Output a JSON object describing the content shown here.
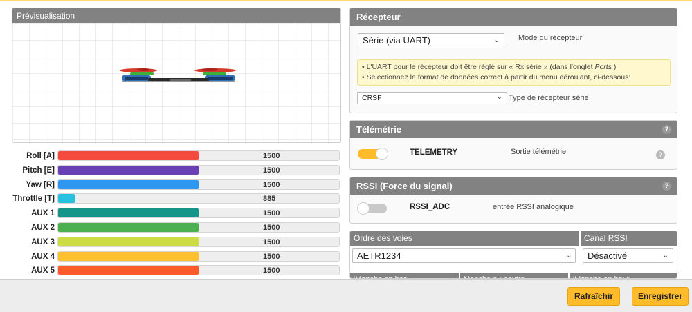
{
  "preview": {
    "title": "Prévisualisation"
  },
  "channels": [
    {
      "label": "Roll [A]",
      "value": "1500",
      "fill": 0.5,
      "color": "#f44b3f"
    },
    {
      "label": "Pitch [E]",
      "value": "1500",
      "fill": 0.5,
      "color": "#6a40b5"
    },
    {
      "label": "Yaw [R]",
      "value": "1500",
      "fill": 0.5,
      "color": "#2f97ef"
    },
    {
      "label": "Throttle [T]",
      "value": "885",
      "fill": 0.06,
      "color": "#28c2de"
    },
    {
      "label": "AUX 1",
      "value": "1500",
      "fill": 0.5,
      "color": "#13958a"
    },
    {
      "label": "AUX 2",
      "value": "1500",
      "fill": 0.5,
      "color": "#4caf50"
    },
    {
      "label": "AUX 3",
      "value": "1500",
      "fill": 0.5,
      "color": "#cddc45"
    },
    {
      "label": "AUX 4",
      "value": "1500",
      "fill": 0.5,
      "color": "#fdc02f"
    },
    {
      "label": "AUX 5",
      "value": "1500",
      "fill": 0.5,
      "color": "#fe5b2d"
    }
  ],
  "receiver": {
    "title": "Récepteur",
    "mode_value": "Série (via UART)",
    "mode_label": "Mode du récepteur",
    "note_line1_prefix": "• L'UART pour le récepteur doit être réglé sur « Rx série » (dans l'onglet ",
    "note_line1_em": "Ports",
    "note_line1_suffix": " )",
    "note_line2": "• Sélectionnez le format de données correct à partir du menu déroulant, ci-dessous:",
    "serial_value": "CRSF",
    "serial_label": "Type de récepteur série"
  },
  "telemetry": {
    "title": "Télémétrie",
    "toggle_on": true,
    "name": "TELEMETRY",
    "description": "Sortie télémétrie"
  },
  "rssi": {
    "title": "RSSI (Force du signal)",
    "toggle_on": false,
    "name": "RSSI_ADC",
    "description": "entrée RSSI analogique"
  },
  "channel_order": {
    "title": "Ordre des voies",
    "value": "AETR1234"
  },
  "rssi_channel": {
    "title": "Canal RSSI",
    "value": "Désactivé"
  },
  "stick_headers": [
    "'Manche en bas'",
    "Manche au neutre",
    "'Manche en haut'"
  ],
  "footer": {
    "refresh_label": "Rafraîchir",
    "save_label": "Enregistrer"
  },
  "colors": {
    "accent": "#ffbb2a",
    "toggle_on": "#ffbb2a",
    "toggle_off": "#c9c9c9",
    "header": "#828282"
  },
  "icons": {
    "help": "help-circle-icon",
    "chevron": "chevron-down-icon"
  }
}
